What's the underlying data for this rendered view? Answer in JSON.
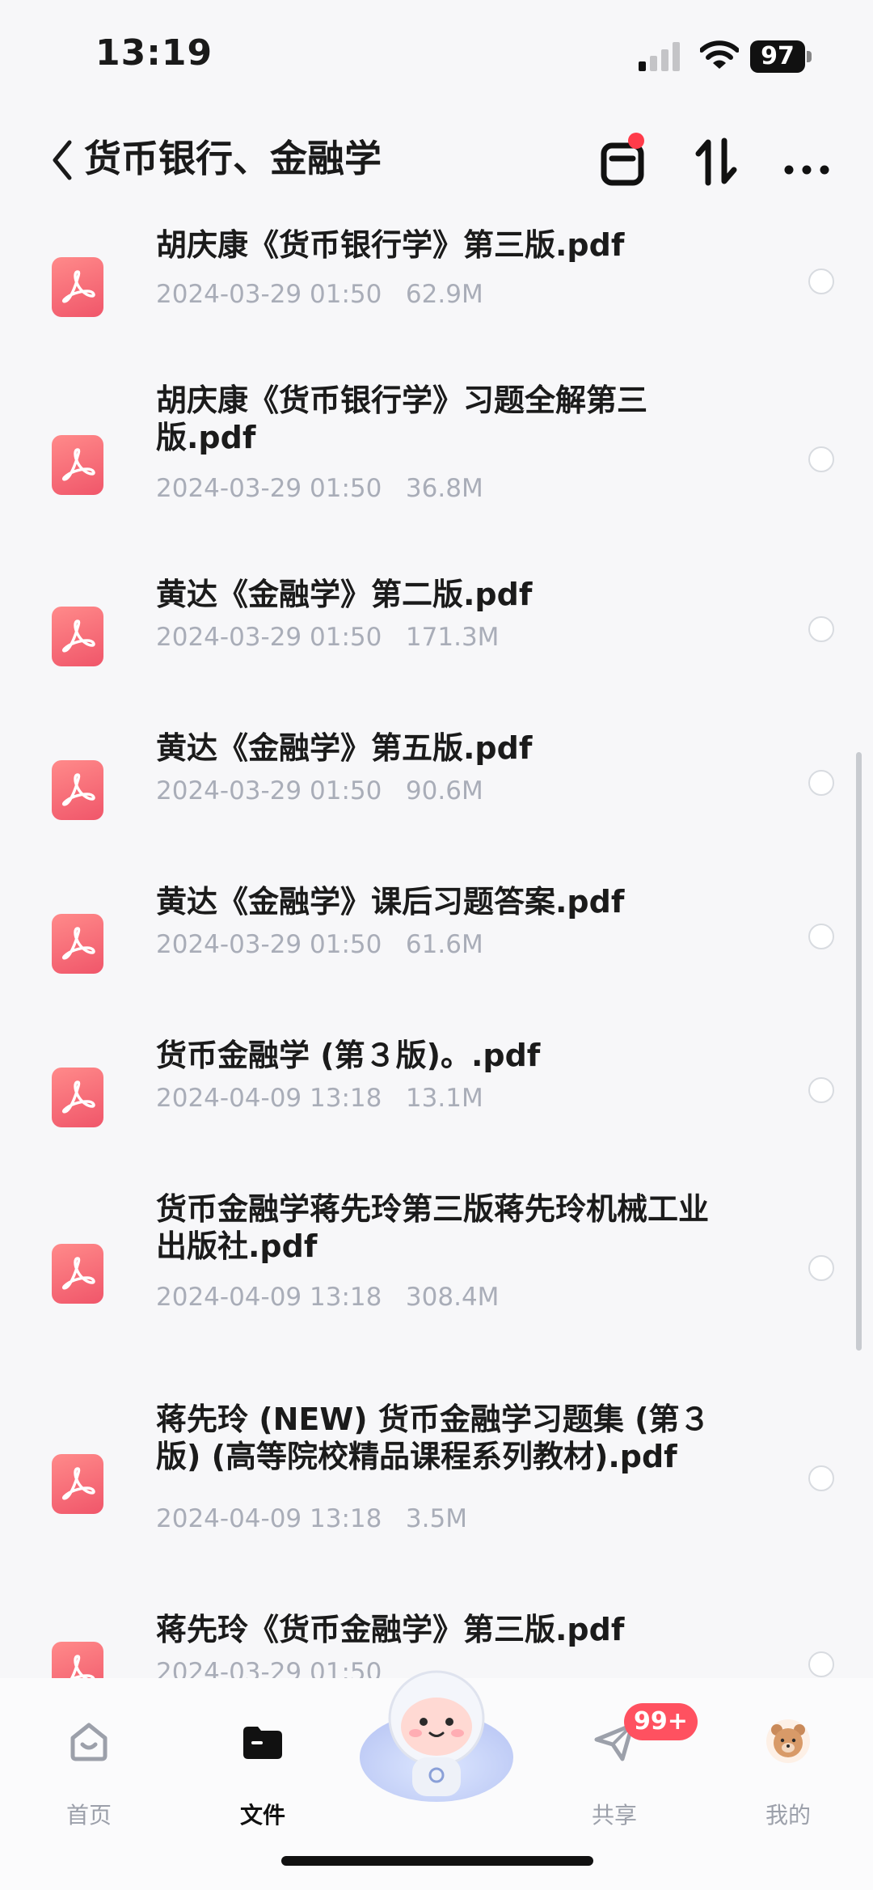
{
  "status": {
    "time": "13:19",
    "battery": "97"
  },
  "nav": {
    "title": "货币银行、金融学",
    "has_notification_dot": true
  },
  "files": [
    {
      "name": "胡庆康《货币银行学》第三版.pdf",
      "date": "2024-03-29 01:50",
      "size": "62.9M"
    },
    {
      "name": "胡庆康《货币银行学》习题全解第三版.pdf",
      "date": "2024-03-29 01:50",
      "size": "36.8M"
    },
    {
      "name": "黄达《金融学》第二版.pdf",
      "date": "2024-03-29 01:50",
      "size": "171.3M"
    },
    {
      "name": "黄达《金融学》第五版.pdf",
      "date": "2024-03-29 01:50",
      "size": "90.6M"
    },
    {
      "name": "黄达《金融学》课后习题答案.pdf",
      "date": "2024-03-29 01:50",
      "size": "61.6M"
    },
    {
      "name": "货币金融学 (第３版)。.pdf",
      "date": "2024-04-09 13:18",
      "size": "13.1M"
    },
    {
      "name": "货币金融学蒋先玲第三版蒋先玲机械工业出版社.pdf",
      "date": "2024-04-09 13:18",
      "size": "308.4M"
    },
    {
      "name": "蒋先玲 (NEW) 货币金融学习题集 (第３版) (高等院校精品课程系列教材).pdf",
      "date": "2024-04-09 13:18",
      "size": "3.5M"
    },
    {
      "name": "蒋先玲《货币金融学》第三版.pdf",
      "date": "2024-03-29 01:50",
      "size": ""
    }
  ],
  "tabbar": {
    "home": "首页",
    "files": "文件",
    "share": "共享",
    "share_badge": "99+",
    "mine": "我的"
  },
  "colors": {
    "pdf_icon": "#f0566a",
    "badge": "#ff5160",
    "meta_text": "#a9adb8"
  }
}
